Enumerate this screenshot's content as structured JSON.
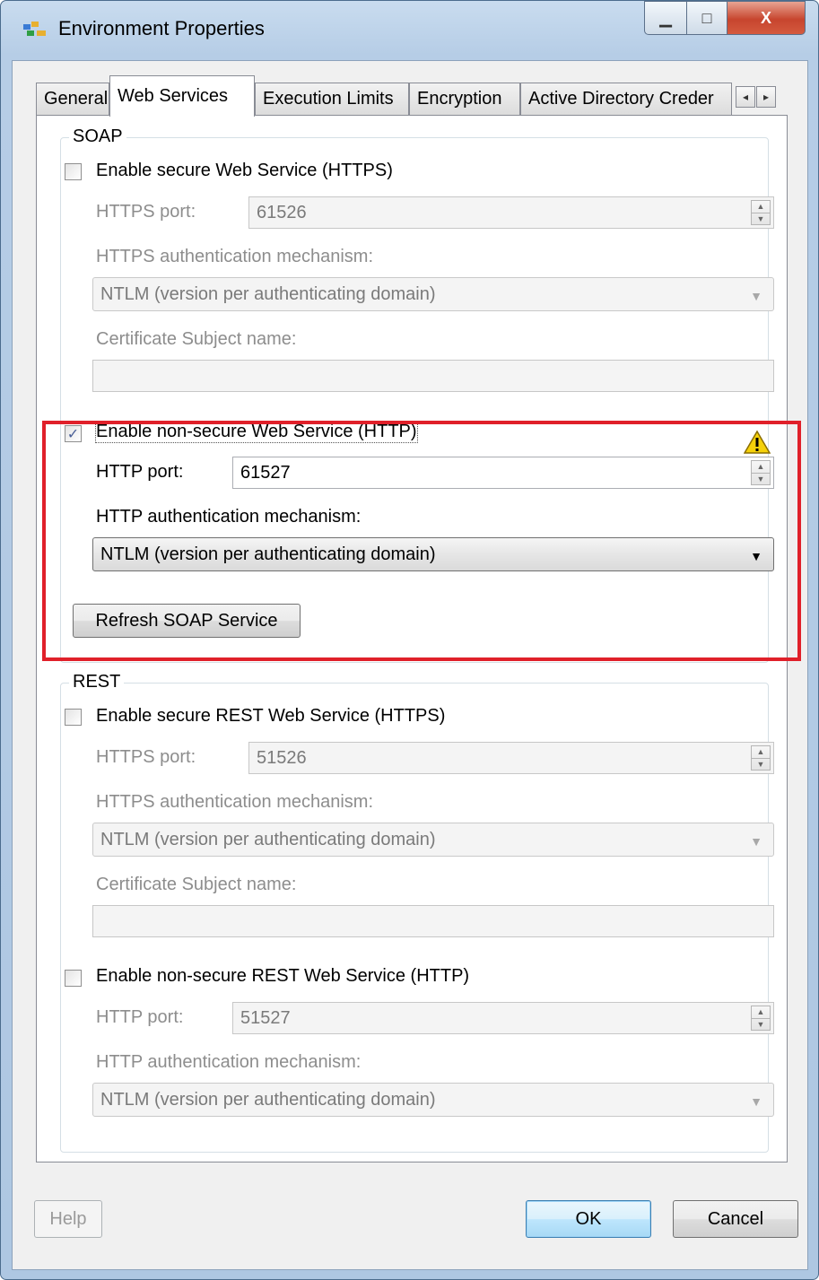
{
  "window": {
    "title": "Environment Properties",
    "caption_buttons": {
      "minimize": "▁",
      "maximize": "□",
      "close": "X"
    }
  },
  "tabs": [
    {
      "label": "General"
    },
    {
      "label": "Web Services",
      "active": true
    },
    {
      "label": "Execution Limits"
    },
    {
      "label": "Encryption"
    },
    {
      "label": "Active Directory Creder"
    }
  ],
  "tab_scroll": {
    "left": "◂",
    "right": "▸"
  },
  "soap": {
    "group_label": "SOAP",
    "https": {
      "enable_label": "Enable secure Web Service (HTTPS)",
      "checked": false,
      "port_label": "HTTPS port:",
      "port_value": "61526",
      "auth_label": "HTTPS authentication mechanism:",
      "auth_value": "NTLM (version per authenticating domain)",
      "cert_label": "Certificate Subject name:",
      "cert_value": ""
    },
    "http": {
      "enable_label": "Enable non-secure Web Service (HTTP)",
      "checked": true,
      "check_glyph": "✓",
      "port_label": "HTTP port:",
      "port_value": "61527",
      "auth_label": "HTTP authentication mechanism:",
      "auth_value": "NTLM (version per authenticating domain)"
    },
    "refresh_button": "Refresh SOAP Service"
  },
  "rest": {
    "group_label": "REST",
    "https": {
      "enable_label": "Enable secure REST Web Service (HTTPS)",
      "checked": false,
      "port_label": "HTTPS port:",
      "port_value": "51526",
      "auth_label": "HTTPS authentication mechanism:",
      "auth_value": "NTLM (version per authenticating domain)",
      "cert_label": "Certificate Subject name:",
      "cert_value": ""
    },
    "http": {
      "enable_label": "Enable non-secure REST Web Service (HTTP)",
      "checked": false,
      "port_label": "HTTP port:",
      "port_value": "51527",
      "auth_label": "HTTP authentication mechanism:",
      "auth_value": "NTLM (version per authenticating domain)"
    }
  },
  "footer": {
    "help": "Help",
    "ok": "OK",
    "cancel": "Cancel"
  },
  "colors": {
    "highlight": "#e0202a",
    "warning": "#f5d10a"
  }
}
